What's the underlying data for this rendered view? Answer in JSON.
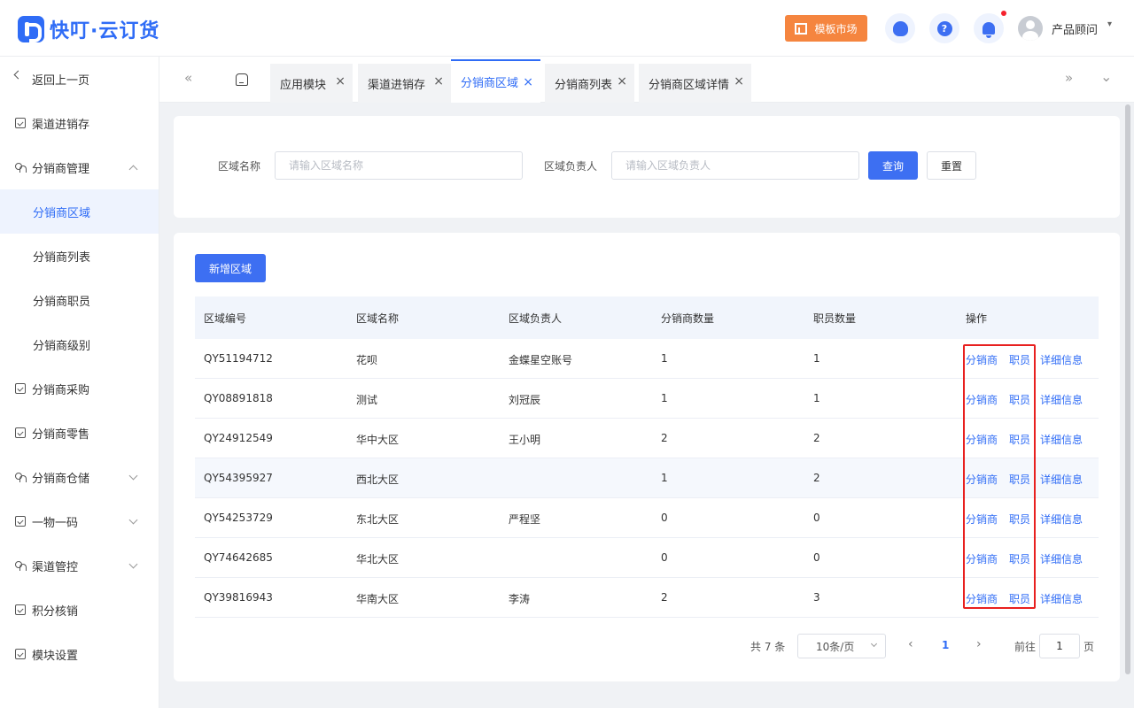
{
  "app": {
    "name": "快叮·云订货"
  },
  "header": {
    "market_label": "模板市场",
    "help_glyph": "?",
    "user_name": "产品顾问",
    "user_caret": "▾"
  },
  "sidebar": {
    "back_label": "返回上一页",
    "items": [
      {
        "label": "渠道进销存"
      },
      {
        "label": "分销商管理"
      },
      {
        "label": "分销商区域"
      },
      {
        "label": "分销商列表"
      },
      {
        "label": "分销商职员"
      },
      {
        "label": "分销商级别"
      },
      {
        "label": "分销商采购"
      },
      {
        "label": "分销商零售"
      },
      {
        "label": "分销商仓储"
      },
      {
        "label": "一物一码"
      },
      {
        "label": "渠道管控"
      },
      {
        "label": "积分核销"
      },
      {
        "label": "模块设置"
      }
    ]
  },
  "tabs": {
    "prev_glyph": "«",
    "next_glyph": "»",
    "more_glyph": "⌄",
    "close_glyph": "×",
    "items": [
      {
        "label": "应用模块"
      },
      {
        "label": "渠道进销存"
      },
      {
        "label": "分销商区域"
      },
      {
        "label": "分销商列表"
      },
      {
        "label": "分销商区域详情"
      }
    ]
  },
  "filters": {
    "region_name_label": "区域名称",
    "region_name_placeholder": "请输入区域名称",
    "manager_label": "区域负责人",
    "manager_placeholder": "请输入区域负责人",
    "query_label": "查询",
    "reset_label": "重置"
  },
  "add_button_label": "新增区域",
  "table": {
    "columns": [
      "区域编号",
      "区域名称",
      "区域负责人",
      "分销商数量",
      "职员数量",
      "操作"
    ],
    "actions": [
      "分销商",
      "职员",
      "详细信息"
    ],
    "rows": [
      {
        "code": "QY51194712",
        "name": "花呗",
        "manager": "金蝶星空账号",
        "distributors": "1",
        "staff": "1"
      },
      {
        "code": "QY08891818",
        "name": "测试",
        "manager": "刘冠辰",
        "distributors": "1",
        "staff": "1"
      },
      {
        "code": "QY24912549",
        "name": "华中大区",
        "manager": "王小明",
        "distributors": "2",
        "staff": "2"
      },
      {
        "code": "QY54395927",
        "name": "西北大区",
        "manager": "",
        "distributors": "1",
        "staff": "2"
      },
      {
        "code": "QY54253729",
        "name": "东北大区",
        "manager": "严程坚",
        "distributors": "0",
        "staff": "0"
      },
      {
        "code": "QY74642685",
        "name": "华北大区",
        "manager": "",
        "distributors": "0",
        "staff": "0"
      },
      {
        "code": "QY39816943",
        "name": "华南大区",
        "manager": "李涛",
        "distributors": "2",
        "staff": "3"
      }
    ]
  },
  "pagination": {
    "total_text": "共 7 条",
    "page_size": "10条/页",
    "prev_glyph": "‹",
    "next_glyph": "›",
    "current_page": "1",
    "goto_prefix": "前往",
    "goto_value": "1",
    "goto_suffix": "页"
  },
  "colors": {
    "primary": "#3d6ff2",
    "accent_orange": "#f5853f",
    "highlight_box": "#e8201f"
  }
}
